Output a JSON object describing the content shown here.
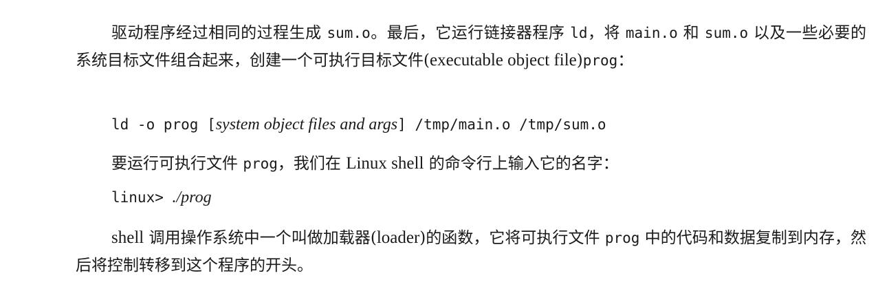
{
  "document": {
    "paragraph_1": {
      "t1": "驱动程序经过相同的过程生成 ",
      "m1": "sum.o",
      "t2": "。最后，它运行链接器程序 ",
      "m2": "ld",
      "t3": "，将 ",
      "m3": "main.o",
      "t4": " 和 ",
      "m4": "sum.o",
      "t5": " 以及一些必要的系统目标文件组合起来，创建一个可执行目标文件(",
      "e1": "executable object file",
      "t6": ")",
      "m5": "prog",
      "t7": "："
    },
    "code_1": {
      "prefix": "ld -o prog [",
      "italic": "system object files and args",
      "suffix": "] /tmp/main.o /tmp/sum.o"
    },
    "paragraph_2": {
      "t1": "要运行可执行文件 ",
      "m1": "prog",
      "t2": "，我们在 ",
      "e1": "Linux shell",
      "t3": " 的命令行上输入它的名字："
    },
    "code_2": {
      "prompt": "linux> ",
      "italic": "./prog"
    },
    "paragraph_3": {
      "e1": "shell",
      "t1": " 调用操作系统中一个叫做加载器(",
      "e2": "loader",
      "t2": ")的函数，它将可执行文件 ",
      "m1": "prog",
      "t3": " 中的代码和数据复制到内存，然后将控制转移到这个程序的开头。"
    }
  }
}
